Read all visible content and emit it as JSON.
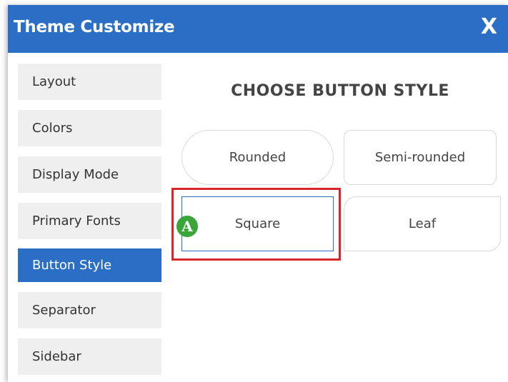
{
  "window": {
    "title": "Theme Customize",
    "close_label": "X"
  },
  "sidebar": {
    "items": [
      {
        "label": "Layout",
        "active": false
      },
      {
        "label": "Colors",
        "active": false
      },
      {
        "label": "Display Mode",
        "active": false
      },
      {
        "label": "Primary Fonts",
        "active": false
      },
      {
        "label": "Button Style",
        "active": true
      },
      {
        "label": "Separator",
        "active": false
      },
      {
        "label": "Sidebar",
        "active": false
      }
    ]
  },
  "main": {
    "heading": "CHOOSE BUTTON STYLE",
    "options": [
      {
        "label": "Rounded",
        "selected": false
      },
      {
        "label": "Semi-rounded",
        "selected": false
      },
      {
        "label": "Square",
        "selected": true
      },
      {
        "label": "Leaf",
        "selected": false
      }
    ],
    "marker_label": "A"
  },
  "colors": {
    "accent": "#2a6ec6",
    "highlight": "#d9262b",
    "marker": "#3aa538"
  }
}
